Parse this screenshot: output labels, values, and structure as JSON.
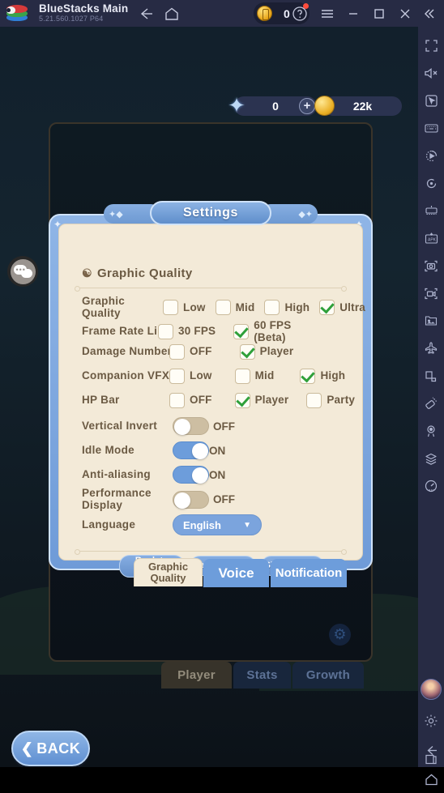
{
  "titlebar": {
    "app_name": "BlueStacks Main",
    "version": "5.21.560.1027  P64",
    "coin_value": "0",
    "icons": {
      "back": "back-arrow-icon",
      "home": "home-icon",
      "help": "help-icon",
      "menu": "hamburger-menu-icon",
      "minimize": "minimize-icon",
      "maximize": "maximize-icon",
      "close": "close-icon",
      "collapse": "collapse-icon"
    }
  },
  "hud": {
    "gem_value": "0",
    "gem_plus": "+",
    "gold_value": "22k"
  },
  "base_tabs": [
    {
      "label": "Player",
      "active": true
    },
    {
      "label": "Stats",
      "active": false
    },
    {
      "label": "Growth",
      "active": false
    }
  ],
  "back_button": {
    "label": "BACK",
    "chevron": "❮"
  },
  "modal": {
    "title": "Settings",
    "section_title": "Graphic  Quality",
    "rows": [
      {
        "label": "Graphic  Quality",
        "type": "checkbox",
        "options": [
          {
            "text": "Low",
            "checked": false
          },
          {
            "text": "Mid",
            "checked": false
          },
          {
            "text": "High",
            "checked": false
          },
          {
            "text": "Ultra",
            "checked": true
          }
        ]
      },
      {
        "label": "Frame  Rate  Limitation",
        "type": "checkbox",
        "options": [
          {
            "text": "30  FPS",
            "checked": false
          },
          {
            "text": "60  FPS\n(Beta)",
            "checked": true
          }
        ]
      },
      {
        "label": "Damage  Number",
        "type": "checkbox",
        "options": [
          {
            "text": "OFF",
            "checked": false
          },
          {
            "text": "Player",
            "checked": true
          }
        ]
      },
      {
        "label": "Companion  VFX",
        "type": "checkbox",
        "options": [
          {
            "text": "Low",
            "checked": false
          },
          {
            "text": "Mid",
            "checked": false
          },
          {
            "text": "High",
            "checked": true
          }
        ]
      },
      {
        "label": "HP  Bar",
        "type": "checkbox",
        "options": [
          {
            "text": "OFF",
            "checked": false
          },
          {
            "text": "Player",
            "checked": true
          },
          {
            "text": "Party",
            "checked": false
          }
        ]
      },
      {
        "label": "Vertical  Invert",
        "type": "toggle",
        "state": "OFF",
        "on": false
      },
      {
        "label": "Idle  Mode",
        "type": "toggle",
        "state": "ON",
        "on": true
      },
      {
        "label": "Anti-aliasing",
        "type": "toggle",
        "state": "ON",
        "on": true
      },
      {
        "label": "Performance\nDisplay",
        "type": "toggle",
        "state": "OFF",
        "on": false
      },
      {
        "label": "Language",
        "type": "select",
        "value": "English",
        "caret": "▼"
      }
    ],
    "buttons": [
      {
        "label": "Back  to\nTitle"
      },
      {
        "label": "Redeem  Code"
      },
      {
        "label": "Skill  Settings"
      }
    ],
    "tabs": [
      {
        "label": "Graphic\nQuality",
        "active": true
      },
      {
        "label": "Voice",
        "active": false
      },
      {
        "label": "Notification",
        "active": false
      }
    ]
  },
  "sidebar": {
    "items": [
      "fullscreen-icon",
      "mute-icon",
      "pointer-icon",
      "keyboard-icon",
      "macro-play-icon",
      "rotate-icon",
      "gamepad-icon",
      "apk-install-icon",
      "screenshot-icon",
      "record-video-icon",
      "media-gallery-icon",
      "airplane-icon",
      "resize-icon",
      "clean-icon",
      "location-icon",
      "multi-instance-icon",
      "performance-icon"
    ],
    "bottom": [
      "avatar",
      "gear-icon",
      "android-back-icon",
      "android-home-icon",
      "android-recents-icon"
    ]
  },
  "chat_button": "chat-bubble-icon",
  "colors": {
    "titlebar_bg": "#272b44",
    "modal_panel": "#f3ead8",
    "accent_blue": "#6d9ddb",
    "check_green": "#2fa03a",
    "label_brown": "#6b5a43"
  }
}
